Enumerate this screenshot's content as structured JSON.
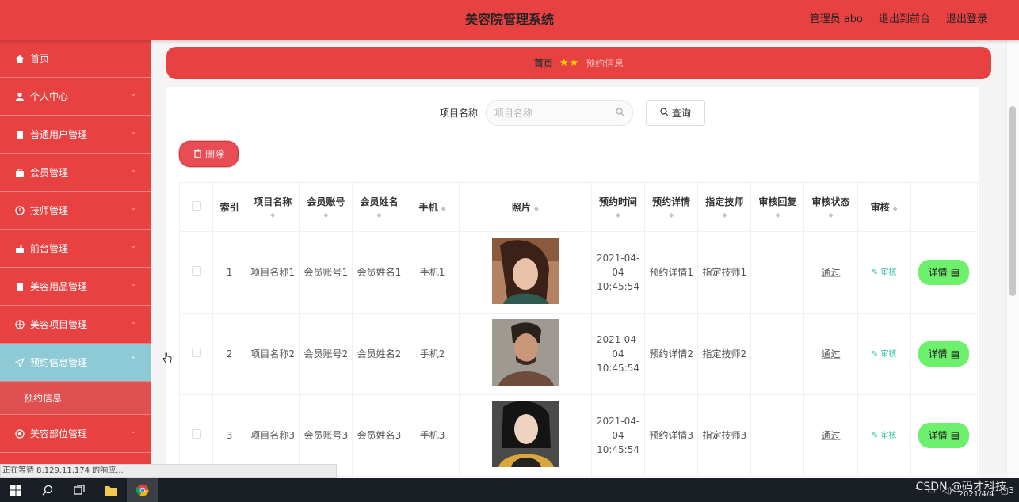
{
  "header": {
    "title": "美容院管理系统",
    "admin_label": "管理员 abo",
    "exit_front_label": "退出到前台",
    "logout_label": "退出登录"
  },
  "sidebar": {
    "items": [
      {
        "label": "首页",
        "icon": "home-icon"
      },
      {
        "label": "个人中心",
        "icon": "user-icon"
      },
      {
        "label": "普通用户管理",
        "icon": "clipboard-icon"
      },
      {
        "label": "会员管理",
        "icon": "briefcase-icon"
      },
      {
        "label": "技师管理",
        "icon": "clock-icon"
      },
      {
        "label": "前台管理",
        "icon": "desk-icon"
      },
      {
        "label": "美容用品管理",
        "icon": "clipboard-icon"
      },
      {
        "label": "美容项目管理",
        "icon": "target-icon"
      },
      {
        "label": "预约信息管理",
        "icon": "send-icon"
      },
      {
        "label": "美容部位管理",
        "icon": "circle-icon"
      }
    ],
    "submenu": {
      "label": "预约信息"
    }
  },
  "breadcrumb": {
    "home": "首页",
    "current": "预约信息"
  },
  "search": {
    "label": "项目名称",
    "placeholder": "项目名称",
    "query_label": "查询"
  },
  "actions": {
    "delete_label": "删除"
  },
  "table": {
    "headers": {
      "index": "索引",
      "project": "项目名称",
      "account": "会员账号",
      "name": "会员姓名",
      "phone": "手机",
      "photo": "照片",
      "time": "预约时间",
      "detail": "预约详情",
      "tech": "指定技师",
      "reply": "审核回复",
      "status": "审核状态",
      "audit": "审核"
    },
    "rows": [
      {
        "index": "1",
        "project": "项目名称1",
        "account": "会员账号1",
        "name": "会员姓名1",
        "phone": "手机1",
        "time": "2021-04-04 10:45:54",
        "detail": "预约详情1",
        "tech": "指定技师1",
        "reply": "",
        "status": "通过",
        "audit": "审核",
        "detail_btn": "详情"
      },
      {
        "index": "2",
        "project": "项目名称2",
        "account": "会员账号2",
        "name": "会员姓名2",
        "phone": "手机2",
        "time": "2021-04-04 10:45:54",
        "detail": "预约详情2",
        "tech": "指定技师2",
        "reply": "",
        "status": "通过",
        "audit": "审核",
        "detail_btn": "详情"
      },
      {
        "index": "3",
        "project": "项目名称3",
        "account": "会员账号3",
        "name": "会员姓名3",
        "phone": "手机3",
        "time": "2021-04-04 10:45:54",
        "detail": "预约详情3",
        "tech": "指定技师3",
        "reply": "",
        "status": "通过",
        "audit": "审核",
        "detail_btn": "详情"
      }
    ]
  },
  "statusbar": {
    "text": "正在等待 8.129.11.174 的响应..."
  },
  "taskbar": {
    "date": "2021/4/4",
    "notification_count": "3"
  },
  "watermark": "CSDN @码才科技",
  "colors": {
    "primary": "#e84142",
    "active_menu": "#8ec9d6",
    "detail_button": "#6df06c",
    "delete_button": "#e84c55",
    "audit_link": "#32c0a0"
  }
}
